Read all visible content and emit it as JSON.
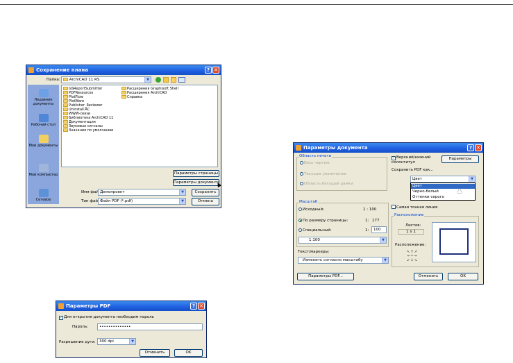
{
  "save_dialog": {
    "title": "Сохранение плана",
    "folder_label": "Папка:",
    "folder_value": "ArchiCAD 11 RS",
    "places": [
      "Недавние документы",
      "Рабочий стол",
      "Мои документы",
      "Мой компьютер",
      "Сетевое"
    ],
    "files_col1": [
      "GSReportSubmitter",
      "PDFResources",
      "PlotFlow",
      "PlotWare",
      "Publisher_Reviewer",
      "Uninstall.AC",
      "WWW-связи",
      "Библиотека ArchiCAD 11",
      "Документация",
      "Звуковые сигналы",
      "Значения по умолчанию"
    ],
    "files_col2": [
      "Расширения Graphisoft Shell",
      "Расширения ArchiCAD",
      "Справка"
    ],
    "page_setup_button": "Параметры страницы",
    "doc_settings_button": "Параметры документа",
    "filename_label": "Имя файла:",
    "filename_value": "Демопроект",
    "filetype_label": "Тип файла:",
    "filetype_value": "Файл PDF (*.pdf)",
    "save_button": "Сохранить",
    "cancel_button": "Отмена"
  },
  "doc_dialog": {
    "title": "Параметры документа",
    "print_area_title": "Область печати",
    "print_area_options": [
      "Весь чертеж",
      "Текущее увеличение",
      "Область бегущей рамки"
    ],
    "header_footer": "Верхний/нижний колонтитул",
    "params_button": "Параметры",
    "save_pdf_as": "Сохранить PDF как...",
    "color_selected": "Цвет",
    "color_options": [
      "Цвет",
      "Черно-белый",
      "Оттенки серого"
    ],
    "scale_title": "Масштаб",
    "original_label": "Исходный:",
    "original_value": "1 : 100",
    "fit_label": "По размеру страницы:",
    "fit_prefix": "1:",
    "fit_value": "177",
    "custom_label": "Специальный:",
    "custom_prefix": "1:",
    "custom_value": "100",
    "custom_select": "1:100",
    "thin_lines": "Самая тонкая линия",
    "position_title": "Расположение",
    "sheets_label": "Листов:",
    "sheets_value": "1 x 1",
    "position_label": "Расположение:",
    "text_markers_label": "Текст/маркеры:",
    "text_markers_value": "Изменить согласно масштабу",
    "pdf_params_button": "Параметры PDF...",
    "cancel_button": "Отменить",
    "ok_button": "OK"
  },
  "pdf_dialog": {
    "title": "Параметры PDF",
    "password_checkbox": "Для открытия документа необходим пароль",
    "password_label": "Пароль:",
    "password_value": "••••••••••••••",
    "resolution_label": "Разрешение дуги:",
    "resolution_value": "300 dpi",
    "cancel_button": "Отменить",
    "ok_button": "OK"
  },
  "colors": {
    "title_blue": "#1f5ee0",
    "dialog_bg": "#ece9d8",
    "select_blue": "#316ac5"
  }
}
